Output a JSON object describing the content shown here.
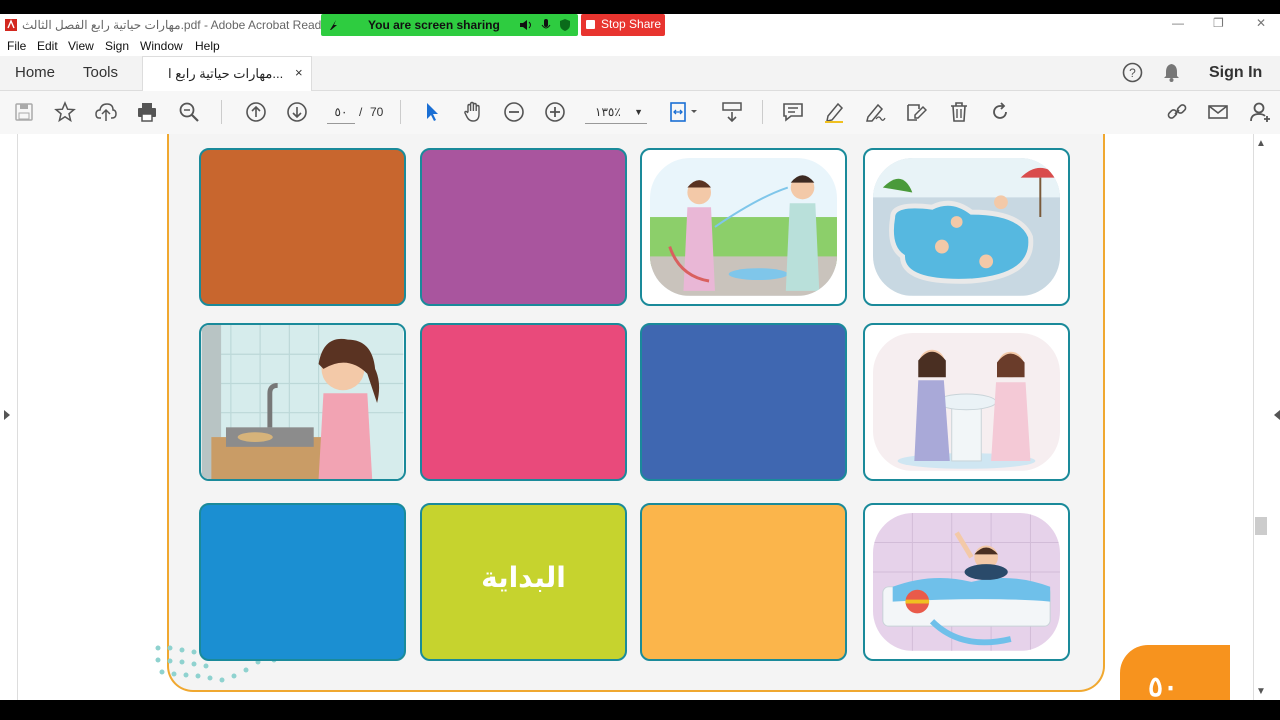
{
  "window": {
    "title": "مهارات حياتية رابع الفصل الثالث.pdf - Adobe Acrobat Reader DC",
    "minimize": "—",
    "restore": "❐",
    "close": "✕"
  },
  "screen_share": {
    "status": "You are screen sharing",
    "stop_label": "Stop Share",
    "bar_color": "#2ecc40",
    "stop_color": "#e8342f"
  },
  "menu": [
    "File",
    "Edit",
    "View",
    "Sign",
    "Window",
    "Help"
  ],
  "tabs": {
    "home": "Home",
    "tools": "Tools",
    "document": "مهارات حياتية رابع ا...",
    "close": "×"
  },
  "header_right": {
    "help_icon": "help-circle-icon",
    "bell_icon": "bell-icon",
    "sign_in": "Sign In"
  },
  "toolbar": {
    "page_current": "٥٠",
    "page_separator": "/",
    "page_total": "70",
    "zoom": "١٣٥٪"
  },
  "page_content": {
    "start_label": "البداية",
    "page_number_badge": "٥٠",
    "tiles": [
      {
        "kind": "color",
        "color": "#c8662e"
      },
      {
        "kind": "color",
        "color": "#a9559e"
      },
      {
        "kind": "picture",
        "subject": "girls-water-hose"
      },
      {
        "kind": "picture",
        "subject": "swimming-pool"
      },
      {
        "kind": "picture",
        "subject": "girl-sink-dishes"
      },
      {
        "kind": "color",
        "color": "#e94a7b"
      },
      {
        "kind": "color",
        "color": "#3f67b1"
      },
      {
        "kind": "picture",
        "subject": "girls-washbasin"
      },
      {
        "kind": "color",
        "color": "#1b8fd2"
      },
      {
        "kind": "color",
        "color": "#c6d32e"
      },
      {
        "kind": "color",
        "color": "#fbb54b"
      },
      {
        "kind": "picture",
        "subject": "boy-bathtub"
      }
    ]
  }
}
